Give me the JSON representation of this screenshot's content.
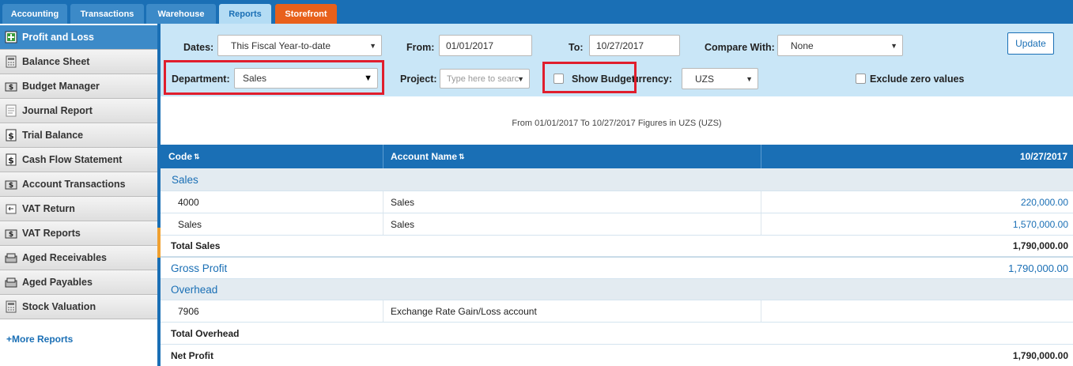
{
  "tabs": [
    {
      "label": "Accounting",
      "active": false
    },
    {
      "label": "Transactions",
      "active": false
    },
    {
      "label": "Warehouse",
      "active": false
    },
    {
      "label": "Reports",
      "active": true
    },
    {
      "label": "Storefront",
      "active": false
    }
  ],
  "sidebar": {
    "items": [
      {
        "label": "Profit and Loss",
        "icon": "plus-chart-icon",
        "active": true
      },
      {
        "label": "Balance Sheet",
        "icon": "calculator-icon"
      },
      {
        "label": "Budget Manager",
        "icon": "coins-icon"
      },
      {
        "label": "Journal Report",
        "icon": "document-icon"
      },
      {
        "label": "Trial Balance",
        "icon": "dollar-icon"
      },
      {
        "label": "Cash Flow Statement",
        "icon": "dollar-icon"
      },
      {
        "label": "Account Transactions",
        "icon": "coins-icon"
      },
      {
        "label": "VAT Return",
        "icon": "return-icon"
      },
      {
        "label": "VAT Reports",
        "icon": "coins-icon"
      },
      {
        "label": "Aged Receivables",
        "icon": "money-stack-icon"
      },
      {
        "label": "Aged Payables",
        "icon": "money-stack-icon"
      },
      {
        "label": "Stock Valuation",
        "icon": "calculator-icon"
      }
    ],
    "more_reports": "+More Reports"
  },
  "filters": {
    "dates_label": "Dates:",
    "dates_value": "This Fiscal Year-to-date",
    "from_label": "From:",
    "from_value": "01/01/2017",
    "to_label": "To:",
    "to_value": "10/27/2017",
    "compare_label": "Compare With:",
    "compare_value": "None",
    "update_label": "Update",
    "department_label": "Department:",
    "department_value": "Sales",
    "project_label": "Project:",
    "project_placeholder": "Type here to searc",
    "show_budget_label": "Show Budget",
    "currency_label": "urrency:",
    "currency_value": "UZS",
    "exclude_zero_label": "Exclude zero values"
  },
  "report": {
    "subtitle": "From 01/01/2017 To 10/27/2017 Figures in UZS (UZS)",
    "columns": {
      "code": "Code",
      "account_name": "Account Name",
      "date": "10/27/2017"
    },
    "sales_section": "Sales",
    "sales_rows": [
      {
        "code": "4000",
        "name": "Sales",
        "amount": "220,000.00"
      },
      {
        "code": "Sales",
        "name": "Sales",
        "amount": "1,570,000.00"
      }
    ],
    "total_sales_label": "Total Sales",
    "total_sales_value": "1,790,000.00",
    "gross_profit_label": "Gross Profit",
    "gross_profit_value": "1,790,000.00",
    "overhead_section": "Overhead",
    "overhead_rows": [
      {
        "code": "7906",
        "name": "Exchange Rate Gain/Loss account",
        "amount": ""
      }
    ],
    "total_overhead_label": "Total Overhead",
    "net_profit_label": "Net Profit",
    "net_profit_value": "1,790,000.00"
  },
  "colors": {
    "primary_blue": "#1a6fb5",
    "storefront_orange": "#e8601b",
    "filter_bg": "#c9e6f7",
    "highlight_red": "#e01e2d"
  }
}
